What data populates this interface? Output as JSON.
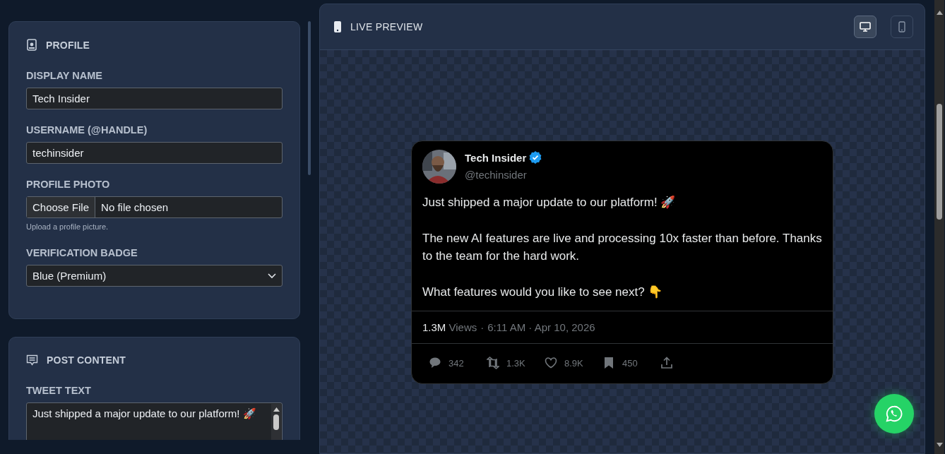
{
  "sections": [
    {
      "kind": "profile",
      "title": "PROFILE",
      "fields": [
        {
          "kind": "text",
          "label": "DISPLAY NAME",
          "value": "Tech Insider"
        },
        {
          "kind": "text",
          "label": "USERNAME (@HANDLE)",
          "value": "techinsider"
        },
        {
          "kind": "file",
          "label": "PROFILE PHOTO",
          "button": "Choose File",
          "value": "No file chosen",
          "hint": "Upload a profile picture."
        },
        {
          "kind": "select",
          "label": "VERIFICATION BADGE",
          "value": "Blue (Premium)"
        }
      ]
    },
    {
      "kind": "post",
      "title": "POST CONTENT",
      "fields": [
        {
          "kind": "textarea",
          "label": "TWEET TEXT",
          "value": "Just shipped a major update to our platform! 🚀"
        }
      ]
    }
  ],
  "preview": {
    "title": "LIVE PREVIEW",
    "view_buttons": [
      {
        "kind": "desktop",
        "selected": true
      },
      {
        "kind": "mobile",
        "selected": false
      }
    ],
    "tweet": {
      "name": "Tech Insider",
      "verified": true,
      "handle": "@techinsider",
      "paragraphs": [
        "Just shipped a major update to our platform! 🚀",
        "The new AI features are live and processing 10x faster than before. Thanks to the team for the hard work.",
        "What features would you like to see next? 👇"
      ],
      "views": "1.3M",
      "views_label": "Views",
      "separator": "·",
      "time": "6:11 AM · Apr 10, 2026",
      "actions": [
        {
          "kind": "reply",
          "count": "342"
        },
        {
          "kind": "retweet",
          "count": "1.3K"
        },
        {
          "kind": "like",
          "count": "8.9K"
        },
        {
          "kind": "bookmark",
          "count": "450"
        },
        {
          "kind": "share"
        }
      ]
    }
  }
}
